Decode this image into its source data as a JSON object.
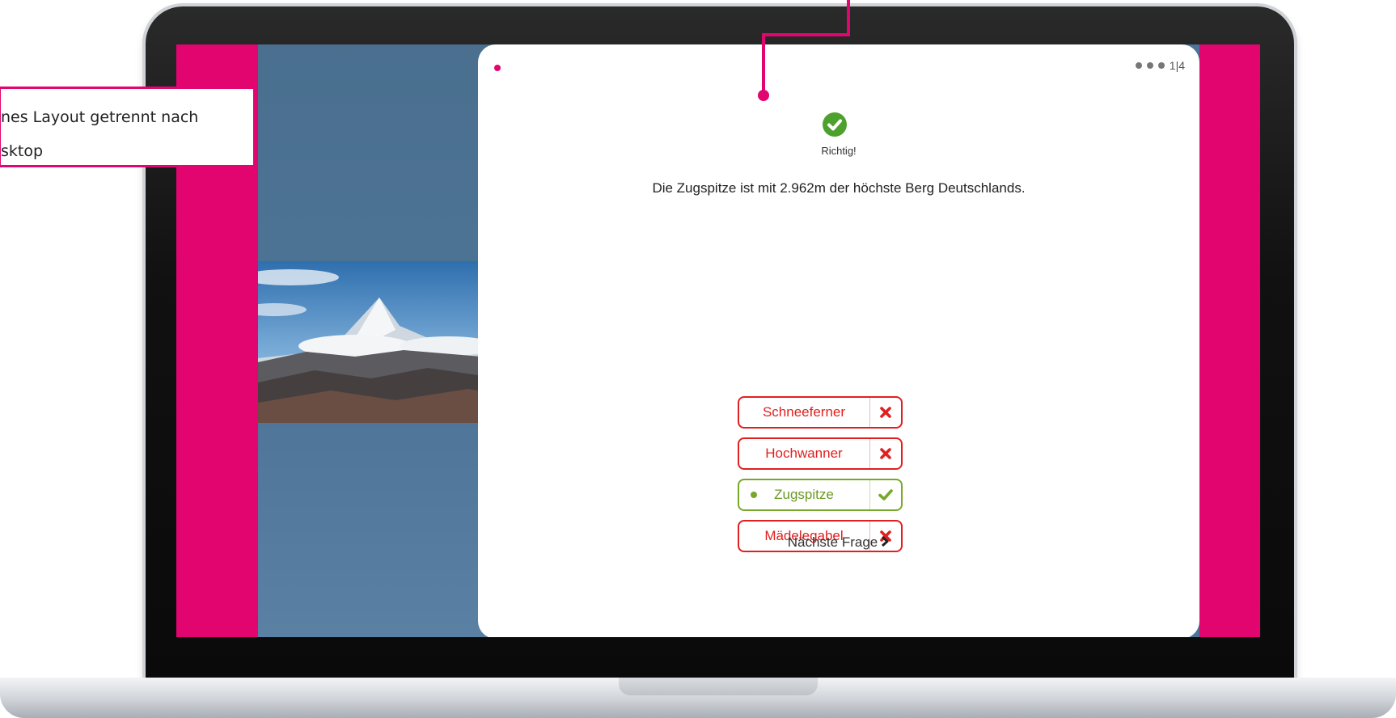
{
  "callout": {
    "line1": "nes Layout getrennt nach",
    "line2": "sktop"
  },
  "quiz": {
    "pager": "1|4",
    "result_label": "Richtig!",
    "explanation": "Die Zugspitze ist mit 2.962m der höchste Berg Deutschlands.",
    "answers": [
      {
        "label": "Schneeferner",
        "state": "wrong"
      },
      {
        "label": "Hochwanner",
        "state": "wrong"
      },
      {
        "label": "Zugspitze",
        "state": "correct"
      },
      {
        "label": "Mädelegabel",
        "state": "wrong"
      }
    ],
    "next_label": "Nächste Frage"
  },
  "colors": {
    "accent": "#e2056f",
    "correct": "#78a82b",
    "wrong": "#e02020",
    "background": "#4e7396"
  }
}
